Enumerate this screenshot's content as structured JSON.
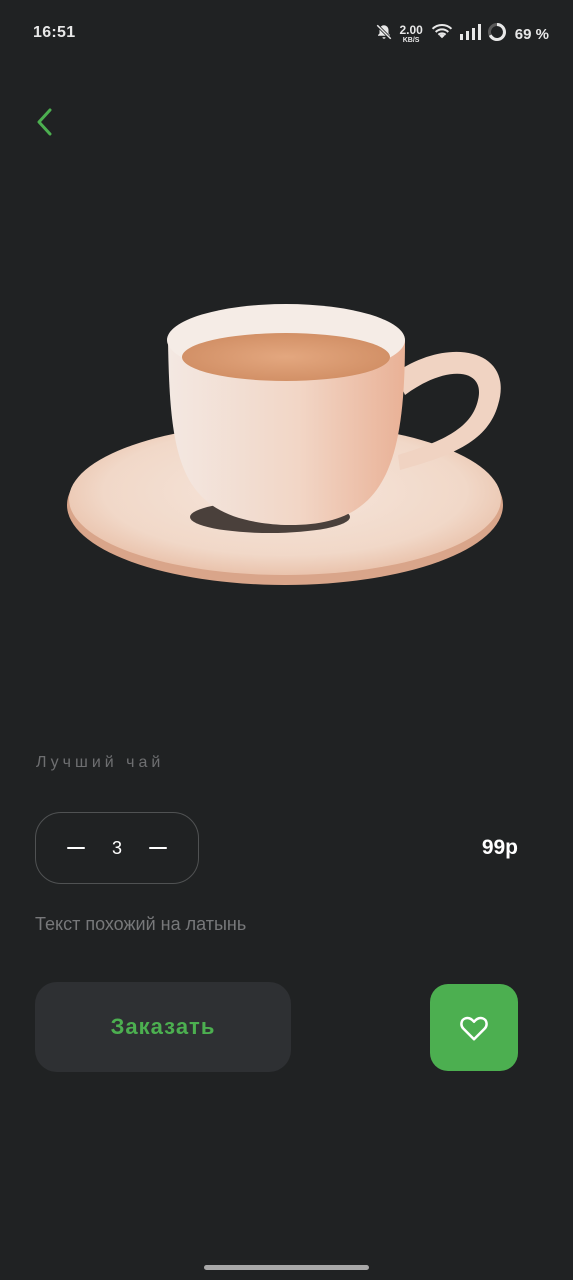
{
  "status_bar": {
    "time": "16:51",
    "net_speed_value": "2.00",
    "net_speed_unit": "KB/S",
    "battery": "69 %",
    "icons": [
      "bell-off-icon",
      "wifi-icon",
      "signal-icon",
      "battery-ring-icon"
    ]
  },
  "navigation": {
    "back_icon": "chevron-left-icon"
  },
  "product": {
    "title": "Лучший чай",
    "quantity": "3",
    "price": "99р",
    "description": "Текст похожий на латынь",
    "image": "cup-of-tea"
  },
  "actions": {
    "order_label": "Заказать",
    "favorite_icon": "heart-icon"
  },
  "colors": {
    "background": "#202223",
    "accent": "#4caf50",
    "button_dark": "#2e3033",
    "muted_text": "#6e6f71"
  }
}
